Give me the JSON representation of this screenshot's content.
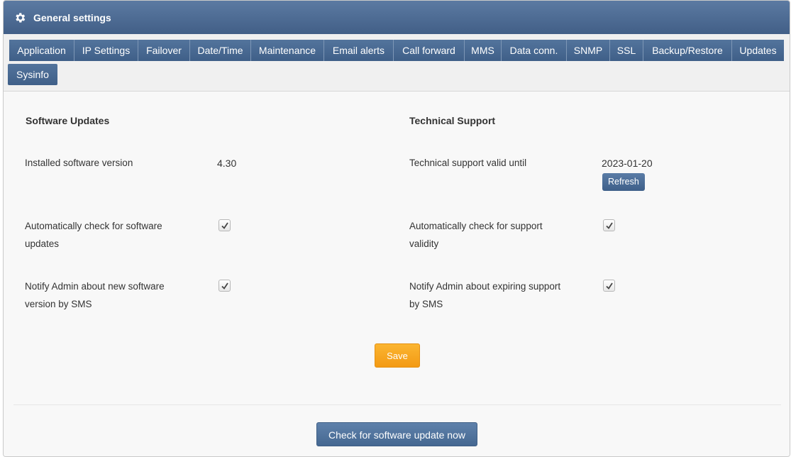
{
  "header": {
    "title": "General settings",
    "icon": "gear-icon"
  },
  "tabs": [
    {
      "label": "Application"
    },
    {
      "label": "IP Settings"
    },
    {
      "label": "Failover"
    },
    {
      "label": "Date/Time"
    },
    {
      "label": "Maintenance"
    },
    {
      "label": "Email alerts"
    },
    {
      "label": "Call forward"
    },
    {
      "label": "MMS"
    },
    {
      "label": "Data conn."
    },
    {
      "label": "SNMP"
    },
    {
      "label": "SSL"
    },
    {
      "label": "Backup/Restore"
    },
    {
      "label": "Updates"
    },
    {
      "label": "Sysinfo"
    }
  ],
  "software_updates": {
    "title": "Software Updates",
    "installed_label": "Installed software version",
    "installed_value": "4.30",
    "auto_check_label_1": "Automatically check for software",
    "auto_check_label_2": "updates",
    "auto_check_checked": true,
    "notify_label_1": "Notify Admin about new software",
    "notify_label_2": "version by SMS",
    "notify_checked": true
  },
  "technical_support": {
    "title": "Technical Support",
    "valid_label": "Technical support valid until",
    "valid_value": "2023-01-20",
    "refresh_label": "Refresh",
    "auto_check_label_1": "Automatically check for support",
    "auto_check_label_2": "validity",
    "auto_check_checked": true,
    "notify_label_1": "Notify Admin about expiring support",
    "notify_label_2": "by SMS",
    "notify_checked": true
  },
  "actions": {
    "save_label": "Save",
    "check_update_label": "Check for software update now"
  },
  "colors": {
    "header_blue": "#4a6a92",
    "tab_blue": "#4a6b94",
    "save_orange": "#f6a21e"
  }
}
